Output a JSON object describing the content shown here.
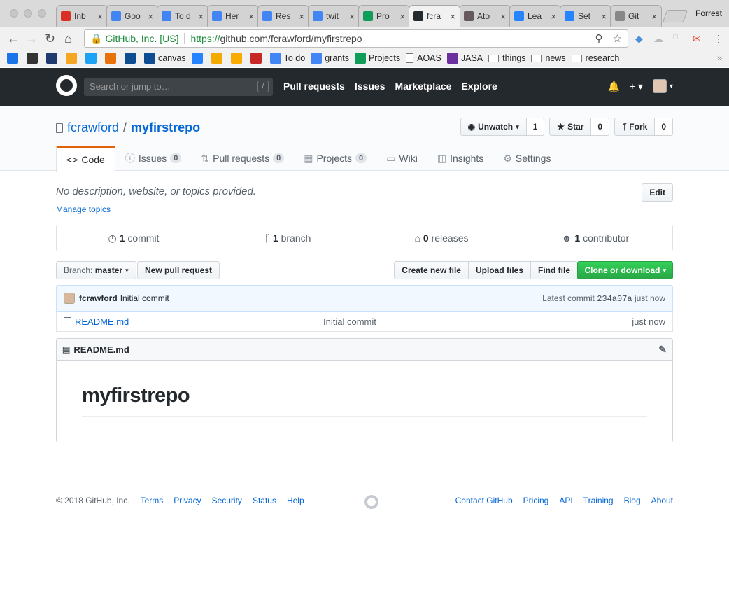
{
  "browser": {
    "tabs": [
      {
        "label": "Inb",
        "icon": "gmail-icon",
        "color": "#d93025"
      },
      {
        "label": "Goo",
        "icon": "calendar-icon",
        "color": "#4285f4"
      },
      {
        "label": "To d",
        "icon": "docs-icon",
        "color": "#4285f4"
      },
      {
        "label": "Her",
        "icon": "docs-icon",
        "color": "#4285f4"
      },
      {
        "label": "Res",
        "icon": "docs-icon",
        "color": "#4285f4"
      },
      {
        "label": "twit",
        "icon": "docs-icon",
        "color": "#4285f4"
      },
      {
        "label": "Pro",
        "icon": "sheets-icon",
        "color": "#0f9d58"
      },
      {
        "label": "fcra",
        "icon": "github-icon",
        "color": "#24292e"
      },
      {
        "label": "Ato",
        "icon": "atom-icon",
        "color": "#66595c"
      },
      {
        "label": "Lea",
        "icon": "atlassian-icon",
        "color": "#2684ff"
      },
      {
        "label": "Set",
        "icon": "atlassian-icon",
        "color": "#2684ff"
      },
      {
        "label": "Git",
        "icon": "page-icon",
        "color": "#888888"
      }
    ],
    "active_tab_index": 7,
    "profile_name": "Forrest",
    "address": {
      "org": "GitHub, Inc. [US]",
      "scheme": "https://",
      "url_rest": "github.com/fcrawford/myfirstrepo"
    },
    "bookmarks": [
      {
        "label": "",
        "icon": "bm-icon-1",
        "color": "#1a73e8",
        "type": "icon"
      },
      {
        "label": "",
        "icon": "bm-icon-2",
        "color": "#333333",
        "type": "icon"
      },
      {
        "label": "",
        "icon": "shield-icon",
        "color": "#1f3a6e",
        "type": "icon"
      },
      {
        "label": "",
        "icon": "arrow-icon",
        "color": "#f5a623",
        "type": "icon"
      },
      {
        "label": "",
        "icon": "twitter-icon",
        "color": "#1da1f2",
        "type": "icon"
      },
      {
        "label": "",
        "icon": "sun-icon",
        "color": "#e8710a",
        "type": "icon"
      },
      {
        "label": "",
        "icon": "yale-icon",
        "color": "#0f4d92",
        "type": "icon"
      },
      {
        "label": "canvas",
        "icon": "yale-icon",
        "color": "#0f4d92",
        "type": "icon"
      },
      {
        "label": "",
        "icon": "bucket-icon",
        "color": "#2684ff",
        "type": "icon"
      },
      {
        "label": "",
        "icon": "w-icon",
        "color": "#f2a900",
        "type": "icon"
      },
      {
        "label": "",
        "icon": "analytics-icon",
        "color": "#f9ab00",
        "type": "icon"
      },
      {
        "label": "",
        "icon": "cross-icon",
        "color": "#c62828",
        "type": "icon"
      },
      {
        "label": "To do",
        "icon": "docs-icon",
        "color": "#4285f4",
        "type": "icon"
      },
      {
        "label": "grants",
        "icon": "docs-icon",
        "color": "#4285f4",
        "type": "icon"
      },
      {
        "label": "Projects",
        "icon": "sheets-icon",
        "color": "#0f9d58",
        "type": "icon"
      },
      {
        "label": "AOAS",
        "icon": "page-icon",
        "color": "#888888",
        "type": "page"
      },
      {
        "label": "JASA",
        "icon": "jasa-icon",
        "color": "#6b2fa0",
        "type": "icon"
      },
      {
        "label": "things",
        "icon": "folder-icon",
        "color": "#777777",
        "type": "folder"
      },
      {
        "label": "news",
        "icon": "folder-icon",
        "color": "#777777",
        "type": "folder"
      },
      {
        "label": "research",
        "icon": "folder-icon",
        "color": "#777777",
        "type": "folder"
      }
    ]
  },
  "header": {
    "search_placeholder": "Search or jump to…",
    "search_key": "/",
    "nav": [
      "Pull requests",
      "Issues",
      "Marketplace",
      "Explore"
    ]
  },
  "repo": {
    "owner": "fcrawford",
    "name": "myfirstrepo",
    "actions": {
      "watch_label": "Unwatch",
      "watch_count": "1",
      "star_label": "Star",
      "star_count": "0",
      "fork_label": "Fork",
      "fork_count": "0"
    },
    "tabs": [
      {
        "label": "Code",
        "icon": "code-icon",
        "count": null
      },
      {
        "label": "Issues",
        "icon": "issue-icon",
        "count": "0"
      },
      {
        "label": "Pull requests",
        "icon": "pr-icon",
        "count": "0"
      },
      {
        "label": "Projects",
        "icon": "project-icon",
        "count": "0"
      },
      {
        "label": "Wiki",
        "icon": "book-icon",
        "count": null
      },
      {
        "label": "Insights",
        "icon": "graph-icon",
        "count": null
      },
      {
        "label": "Settings",
        "icon": "gear-icon",
        "count": null
      }
    ],
    "description": "No description, website, or topics provided.",
    "edit_label": "Edit",
    "manage_topics": "Manage topics",
    "summary": [
      {
        "count": "1",
        "label": "commit",
        "icon": "history-icon"
      },
      {
        "count": "1",
        "label": "branch",
        "icon": "branch-icon"
      },
      {
        "count": "0",
        "label": "releases",
        "icon": "tag-icon"
      },
      {
        "count": "1",
        "label": "contributor",
        "icon": "people-icon"
      }
    ],
    "branch_label": "Branch:",
    "branch_name": "master",
    "new_pr": "New pull request",
    "file_actions": [
      "Create new file",
      "Upload files",
      "Find file"
    ],
    "clone_label": "Clone or download",
    "latest_commit": {
      "author": "fcrawford",
      "message": "Initial commit",
      "prefix": "Latest commit",
      "sha": "234a07a",
      "age": "just now"
    },
    "files": [
      {
        "name": "README.md",
        "message": "Initial commit",
        "age": "just now"
      }
    ],
    "readme": {
      "filename": "README.md",
      "heading": "myfirstrepo"
    }
  },
  "footer": {
    "copyright": "© 2018 GitHub, Inc.",
    "left_links": [
      "Terms",
      "Privacy",
      "Security",
      "Status",
      "Help"
    ],
    "right_links": [
      "Contact GitHub",
      "Pricing",
      "API",
      "Training",
      "Blog",
      "About"
    ]
  }
}
